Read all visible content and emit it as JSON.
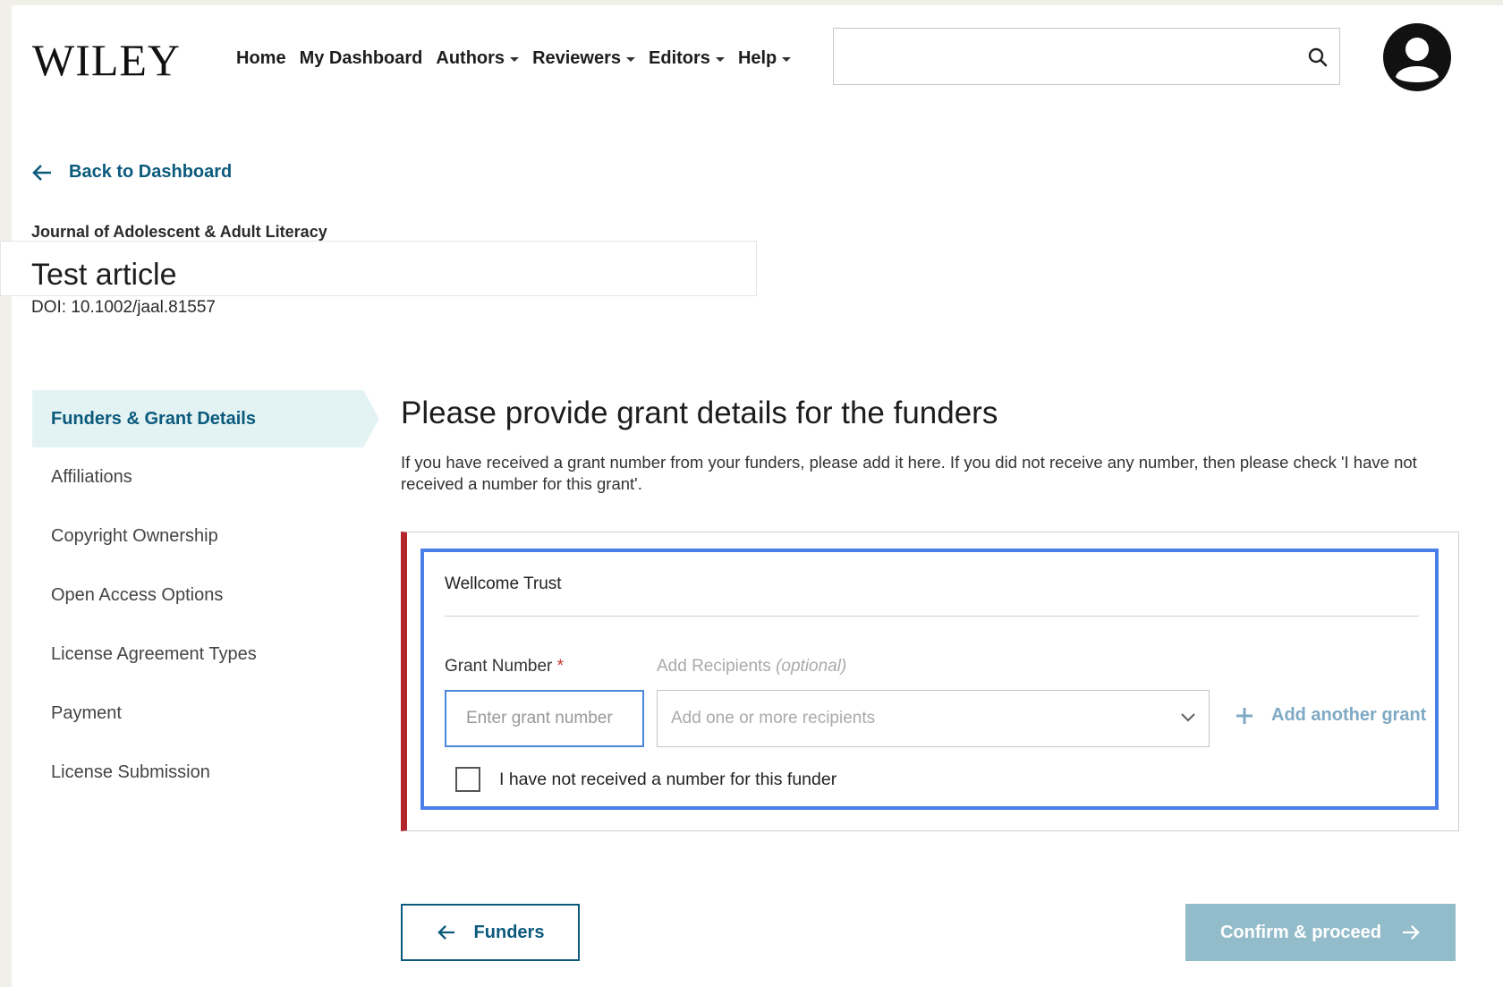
{
  "header": {
    "logo": "WILEY",
    "nav": [
      {
        "label": "Home",
        "dropdown": false
      },
      {
        "label": "My Dashboard",
        "dropdown": false
      },
      {
        "label": "Authors",
        "dropdown": true
      },
      {
        "label": "Reviewers",
        "dropdown": true
      },
      {
        "label": "Editors",
        "dropdown": true
      },
      {
        "label": "Help",
        "dropdown": true
      }
    ],
    "search_value": ""
  },
  "back_link": "Back to Dashboard",
  "article": {
    "journal": "Journal of Adolescent & Adult Literacy",
    "title": "Test article",
    "doi": "DOI: 10.1002/jaal.81557"
  },
  "sidebar": {
    "items": [
      {
        "label": "Funders & Grant Details",
        "active": true
      },
      {
        "label": "Affiliations",
        "active": false
      },
      {
        "label": "Copyright Ownership",
        "active": false
      },
      {
        "label": "Open Access Options",
        "active": false
      },
      {
        "label": "License Agreement Types",
        "active": false
      },
      {
        "label": "Payment",
        "active": false
      },
      {
        "label": "License Submission",
        "active": false
      }
    ]
  },
  "main": {
    "heading": "Please provide grant details for the funders",
    "intro": "If you have received a grant number from your funders, please add it here. If you did not receive any number, then please check 'I have not received a number for this grant'.",
    "funder": {
      "name": "Wellcome Trust",
      "grant_label": "Grant Number",
      "required_mark": "*",
      "grant_placeholder": "Enter grant number",
      "recipients_label": "Add Recipients",
      "recipients_optional": "(optional)",
      "recipients_placeholder": "Add one or more recipients",
      "add_grant": "Add another grant",
      "no_number_label": "I have not received a number for this funder",
      "no_number_checked": false
    }
  },
  "footer": {
    "back_button": "Funders",
    "confirm_button": "Confirm & proceed"
  },
  "colors": {
    "accent": "#0b5a7c",
    "active_bg": "#e3f3f4",
    "error_bar": "#b3262b",
    "focus_border": "#4a7ee8",
    "confirm_disabled": "#93bcca"
  }
}
